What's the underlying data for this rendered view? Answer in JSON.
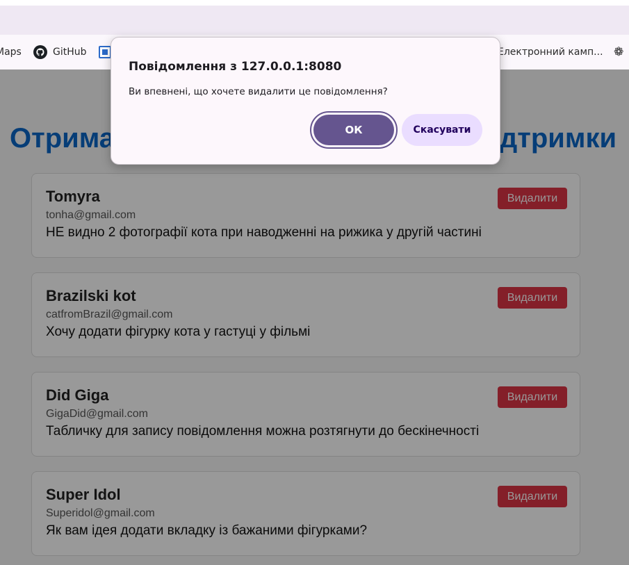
{
  "browser": {
    "bookmarks": [
      {
        "label": "Maps"
      },
      {
        "label": "GitHub"
      },
      {
        "label": ""
      },
      {
        "label": "Електронний камп..."
      }
    ]
  },
  "page": {
    "title": "Отримані повідомлення з форми підтримки",
    "delete_label": "Видалити",
    "messages": [
      {
        "name": "Tomyra",
        "email": "tonha@gmail.com",
        "text": "НЕ видно 2 фотографії кота при наводженні на рижика у другій частині"
      },
      {
        "name": "Brazilski kot",
        "email": "catfromBrazil@gmail.com",
        "text": "Хочу додати фігурку кота у гастуці у фільмі"
      },
      {
        "name": "Did Giga",
        "email": "GigaDid@gmail.com",
        "text": "Табличку для запису повідомлення можна розтягнути до бескінечності"
      },
      {
        "name": "Super Idol",
        "email": "Superidol@gmail.com",
        "text": "Як вам ідея додати вкладку із бажаними фігурками?"
      }
    ]
  },
  "dialog": {
    "title": "Повідомлення з 127.0.0.1:8080",
    "text": "Ви впевнені, що хочете видалити це повідомлення?",
    "ok_label": "ОК",
    "cancel_label": "Скасувати"
  },
  "colors": {
    "title_blue": "#0a66c7",
    "delete_red": "#dc3545",
    "ok_purple": "#65558f",
    "cancel_lavender": "#eaddff"
  }
}
